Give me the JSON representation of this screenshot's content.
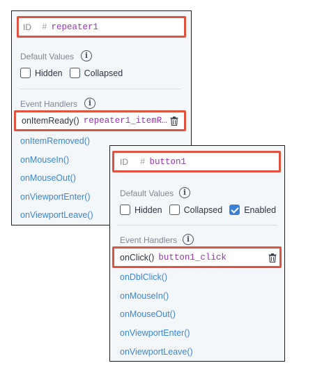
{
  "repeater_panel": {
    "id_label": "ID",
    "id_hash": "#",
    "id_value": "repeater1",
    "default_values_label": "Default Values",
    "hidden_label": "Hidden",
    "collapsed_label": "Collapsed",
    "hidden_checked": false,
    "collapsed_checked": false,
    "event_handlers_label": "Event Handlers",
    "active_handler": {
      "name": "onItemReady()",
      "function": "repeater1_itemR…"
    },
    "events": [
      "onItemRemoved()",
      "onMouseIn()",
      "onMouseOut()",
      "onViewportEnter()",
      "onViewportLeave()"
    ]
  },
  "button_panel": {
    "id_label": "ID",
    "id_hash": "#",
    "id_value": "button1",
    "default_values_label": "Default Values",
    "hidden_label": "Hidden",
    "collapsed_label": "Collapsed",
    "enabled_label": "Enabled",
    "hidden_checked": false,
    "collapsed_checked": false,
    "enabled_checked": true,
    "event_handlers_label": "Event Handlers",
    "active_handler": {
      "name": "onClick()",
      "function": "button1_click"
    },
    "events": [
      "onDblClick()",
      "onMouseIn()",
      "onMouseOut()",
      "onViewportEnter()",
      "onViewportLeave()"
    ]
  },
  "info_icon_glyph": "i",
  "colors": {
    "highlight": "#e0533e",
    "link": "#3a86d6",
    "function": "#9a32b8",
    "checkbox_checked": "#3b82d6"
  }
}
